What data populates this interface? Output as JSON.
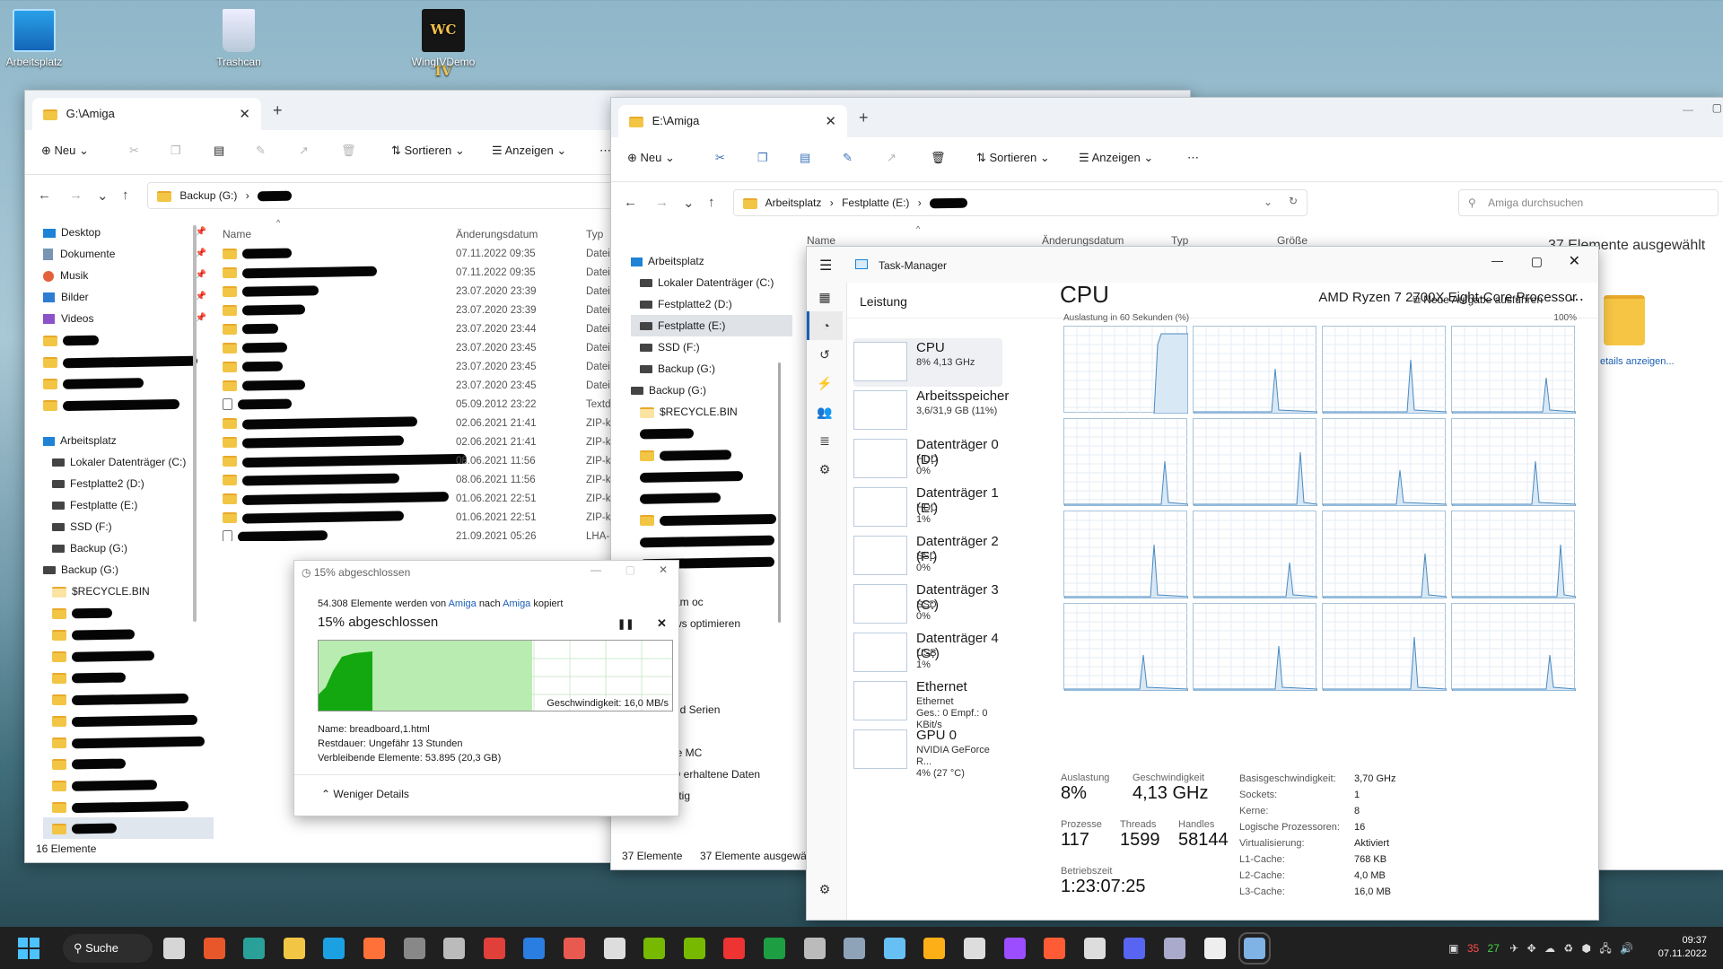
{
  "desktop": {
    "icons": [
      {
        "label": "Arbeitsplatz"
      },
      {
        "label": "Trashcan"
      },
      {
        "label": "WingIVDemo"
      }
    ],
    "logo_text": "WC IV"
  },
  "explorer_left": {
    "tab_title": "G:\\Amiga",
    "toolbar": {
      "new": "Neu",
      "sort": "Sortieren",
      "view": "Anzeigen"
    },
    "breadcrumb": [
      "Backup (G:)"
    ],
    "sidebar": [
      {
        "label": "Desktop"
      },
      {
        "label": "Dokumente"
      },
      {
        "label": "Musik"
      },
      {
        "label": "Bilder"
      },
      {
        "label": "Videos"
      }
    ],
    "tree": [
      {
        "label": "Arbeitsplatz"
      },
      {
        "label": "Lokaler Datenträger (C:)"
      },
      {
        "label": "Festplatte2 (D:)"
      },
      {
        "label": "Festplatte (E:)"
      },
      {
        "label": "SSD (F:)"
      },
      {
        "label": "Backup (G:)"
      },
      {
        "label": "Backup (G:)"
      },
      {
        "label": "$RECYCLE.BIN"
      }
    ],
    "columns": {
      "name": "Name",
      "date": "Änderungsdatum",
      "type": "Typ"
    },
    "rows": [
      {
        "date": "07.11.2022 09:35",
        "type": "Datei"
      },
      {
        "date": "07.11.2022 09:35",
        "type": "Datei"
      },
      {
        "date": "23.07.2020 23:39",
        "type": "Datei"
      },
      {
        "date": "23.07.2020 23:39",
        "type": "Datei"
      },
      {
        "date": "23.07.2020 23:44",
        "type": "Datei"
      },
      {
        "date": "23.07.2020 23:45",
        "type": "Datei"
      },
      {
        "date": "23.07.2020 23:45",
        "type": "Datei"
      },
      {
        "date": "23.07.2020 23:45",
        "type": "Datei"
      },
      {
        "date": "05.09.2012 23:22",
        "type": "Textd"
      },
      {
        "date": "02.06.2021 21:41",
        "type": "ZIP-k"
      },
      {
        "date": "02.06.2021 21:41",
        "type": "ZIP-k"
      },
      {
        "date": "08.06.2021 11:56",
        "type": "ZIP-k"
      },
      {
        "date": "08.06.2021 11:56",
        "type": "ZIP-k"
      },
      {
        "date": "01.06.2021 22:51",
        "type": "ZIP-k"
      },
      {
        "date": "01.06.2021 22:51",
        "type": "ZIP-k"
      },
      {
        "date": "21.09.2021 05:26",
        "type": "LHA-"
      }
    ],
    "status": "16 Elemente"
  },
  "explorer_right": {
    "tab_title": "E:\\Amiga",
    "toolbar": {
      "new": "Neu",
      "sort": "Sortieren",
      "view": "Anzeigen"
    },
    "breadcrumb": [
      "Arbeitsplatz",
      "Festplatte (E:)"
    ],
    "search_placeholder": "Amiga durchsuchen",
    "columns": {
      "name": "Name",
      "date": "Änderungsdatum",
      "type": "Typ",
      "size": "Größe"
    },
    "tree": [
      {
        "label": "Arbeitsplatz"
      },
      {
        "label": "Lokaler Datenträger (C:)"
      },
      {
        "label": "Festplatte2 (D:)"
      },
      {
        "label": "Festplatte (E:)"
      },
      {
        "label": "SSD (F:)"
      },
      {
        "label": "Backup (G:)"
      },
      {
        "label": "Backup (G:)"
      },
      {
        "label": "$RECYCLE.BIN"
      }
    ],
    "partial_items": [
      "am oc",
      "ws optimieren",
      "nd Serien",
      "le MC",
      "ICQ erhaltene Daten",
      "Lustig"
    ],
    "details_title": "37 Elemente ausgewählt",
    "details_link": "etails anzeigen...",
    "status": "37 Elemente",
    "status_sel": "37 Elemente ausgewä"
  },
  "copy_dialog": {
    "title": "15% abgeschlossen",
    "desc_pre": "54.308 Elemente werden von",
    "desc_src": "Amiga",
    "desc_mid": "nach",
    "desc_dst": "Amiga",
    "desc_post": "kopiert",
    "heading": "15% abgeschlossen",
    "progress": 0.15,
    "speed": "Geschwindigkeit: 16,0 MB/s",
    "name": "Name:  breadboard,1.html",
    "remaining": "Restdauer:  Ungefähr 13 Stunden",
    "items_left": "Verbleibende Elemente:  53.895 (20,3 GB)",
    "less": "Weniger Details"
  },
  "taskmanager": {
    "title": "Task-Manager",
    "section": "Leistung",
    "run_task": "Neue Aufgabe ausführen",
    "perf_items": [
      {
        "name": "CPU",
        "sub1": "8% 4,13 GHz",
        "sub2": ""
      },
      {
        "name": "Arbeitsspeicher",
        "sub1": "3,6/31,9 GB (11%)",
        "sub2": ""
      },
      {
        "name": "Datenträger 0 (D:)",
        "sub1": "HDD",
        "sub2": "0%"
      },
      {
        "name": "Datenträger 1 (E:)",
        "sub1": "HDD",
        "sub2": "1%"
      },
      {
        "name": "Datenträger 2 (F:)",
        "sub1": "SSD",
        "sub2": "0%"
      },
      {
        "name": "Datenträger 3 (C:)",
        "sub1": "SSD",
        "sub2": "0%"
      },
      {
        "name": "Datenträger 4 (G:)",
        "sub1": "USB",
        "sub2": "1%"
      },
      {
        "name": "Ethernet",
        "sub1": "Ethernet",
        "sub2": "Ges.: 0 Empf.: 0 KBit/s"
      },
      {
        "name": "GPU 0",
        "sub1": "NVIDIA GeForce R...",
        "sub2": "4% (27 °C)"
      }
    ],
    "cpu_title": "CPU",
    "cpu_model": "AMD Ryzen 7 2700X Eight-Core Processor",
    "graph_label": "Auslastung in 60 Sekunden (%)",
    "graph_max": "100%",
    "stats": {
      "util_l": "Auslastung",
      "util_v": "8%",
      "speed_l": "Geschwindigkeit",
      "speed_v": "4,13 GHz",
      "proc_l": "Prozesse",
      "proc_v": "117",
      "thr_l": "Threads",
      "thr_v": "1599",
      "hnd_l": "Handles",
      "hnd_v": "58144",
      "up_l": "Betriebszeit",
      "up_v": "1:23:07:25"
    },
    "specs": [
      {
        "k": "Basisgeschwindigkeit:",
        "v": "3,70 GHz"
      },
      {
        "k": "Sockets:",
        "v": "1"
      },
      {
        "k": "Kerne:",
        "v": "8"
      },
      {
        "k": "Logische Prozessoren:",
        "v": "16"
      },
      {
        "k": "Virtualisierung:",
        "v": "Aktiviert"
      },
      {
        "k": "L1-Cache:",
        "v": "768 KB"
      },
      {
        "k": "L2-Cache:",
        "v": "4,0 MB"
      },
      {
        "k": "L3-Cache:",
        "v": "16,0 MB"
      }
    ]
  },
  "taskbar": {
    "search": "Suche",
    "tray": {
      "n1": "35",
      "n2": "27"
    },
    "time": "09:37",
    "date": "07.11.2022"
  }
}
